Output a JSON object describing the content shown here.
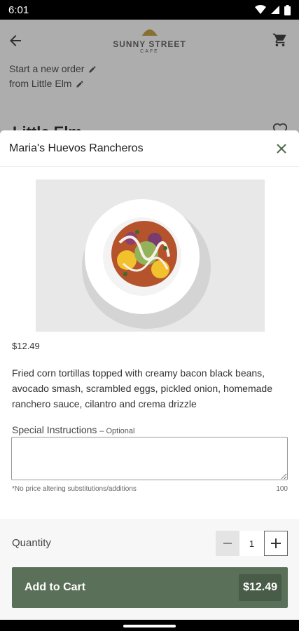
{
  "status_bar": {
    "time": "6:01"
  },
  "background": {
    "logo_main": "SUNNY STREET",
    "logo_sub": "CAFE",
    "order_line1": "Start a new order",
    "order_line2": "from Little Elm",
    "location": "Little Elm"
  },
  "item": {
    "title": "Maria's Huevos Rancheros",
    "price": "$12.49",
    "description": "Fried corn tortillas topped with creamy bacon black beans, avocado smash, scrambled eggs, pickled onion, homemade ranchero sauce, cilantro and crema drizzle"
  },
  "special_instructions": {
    "label": "Special Instructions",
    "optional": "– Optional",
    "value": "",
    "note": "*No price altering substitutions/additions",
    "char_count": "100"
  },
  "quantity": {
    "label": "Quantity",
    "value": "1"
  },
  "add_to_cart": {
    "label": "Add to Cart",
    "price": "$12.49"
  },
  "colors": {
    "accent": "#5a7058",
    "accent_dark": "#485c47"
  }
}
